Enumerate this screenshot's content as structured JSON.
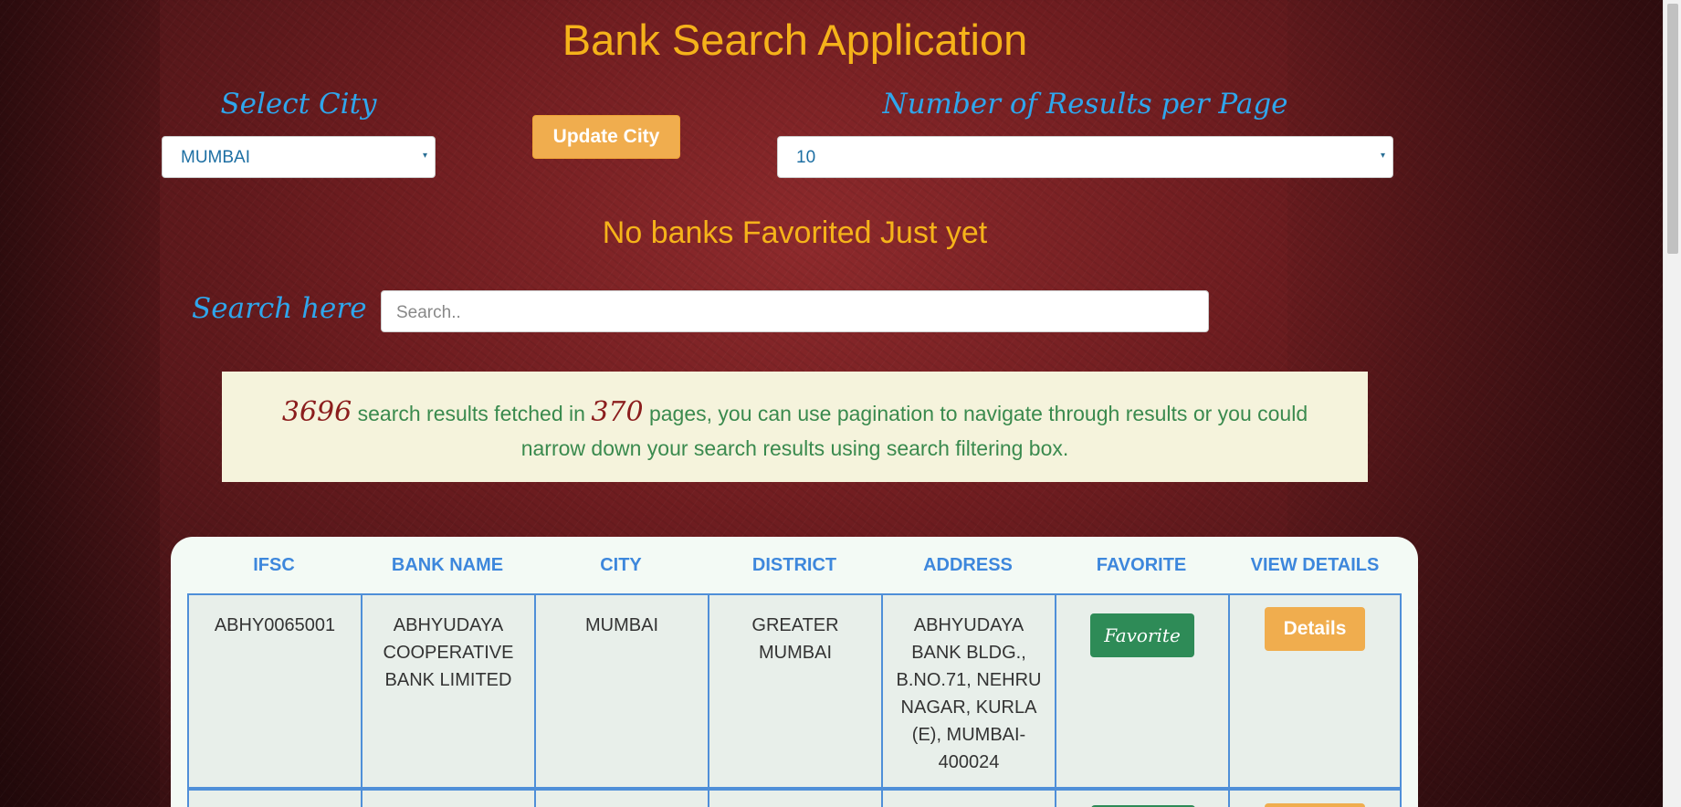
{
  "app": {
    "title": "Bank Search Application"
  },
  "controls": {
    "city_label": "Select City",
    "city_value": "MUMBAI",
    "update_button": "Update City",
    "results_label": "Number of Results per Page",
    "results_value": "10",
    "caret": "▾"
  },
  "favorites": {
    "message": "No banks Favorited Just yet"
  },
  "search": {
    "label": "Search here",
    "placeholder": "Search.."
  },
  "info": {
    "results_count": "3696",
    "text_part1": " search results fetched in ",
    "pages_count": "370",
    "text_part2": " pages, you can use pagination to navigate through results or you could narrow down your search results using search filtering box."
  },
  "table": {
    "headers": [
      "IFSC",
      "BANK NAME",
      "CITY",
      "DISTRICT",
      "ADDRESS",
      "FAVORITE",
      "VIEW DETAILS"
    ],
    "rows": [
      {
        "ifsc": "ABHY0065001",
        "bank_name": "ABHYUDAYA COOPERATIVE BANK LIMITED",
        "city": "MUMBAI",
        "district": "GREATER MUMBAI",
        "address": "ABHYUDAYA BANK BLDG., B.NO.71, NEHRU NAGAR, KURLA (E), MUMBAI-400024",
        "favorite_label": "Favorite",
        "details_label": "Details"
      }
    ]
  },
  "colors": {
    "title": "#f5b31a",
    "script_label": "#2fa6ec",
    "header_text": "#3d87dc",
    "favorite_button": "#2e8b57",
    "details_button": "#f0ad4e"
  }
}
